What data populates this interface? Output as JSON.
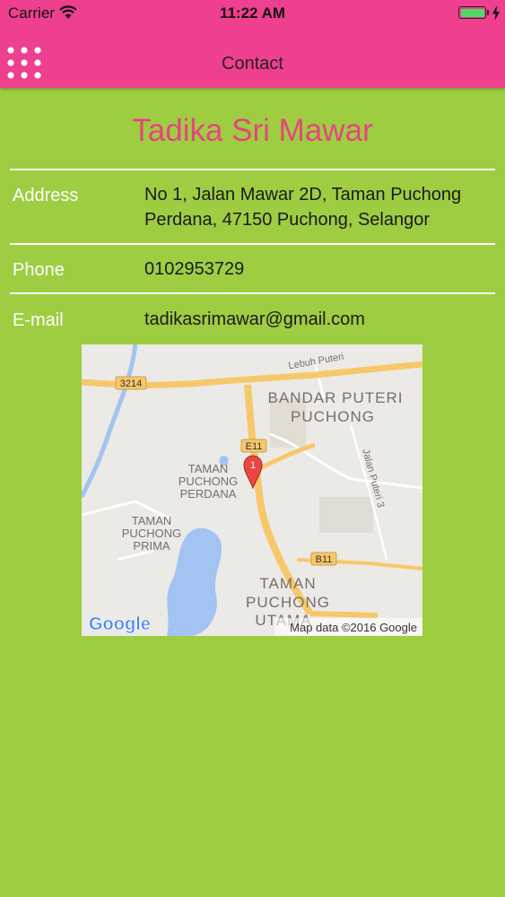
{
  "status_bar": {
    "carrier": "Carrier",
    "time": "11:22 AM",
    "wifi_icon": "wifi-icon",
    "battery_icon": "battery-icon",
    "battery_level_percent": 100,
    "charging_icon": "charging-bolt-icon"
  },
  "nav": {
    "menu_icon": "grid-menu-icon",
    "title": "Contact"
  },
  "school": {
    "name": "Tadika Sri Mawar"
  },
  "contact": {
    "address_label": "Address",
    "address_value": "No 1, Jalan Mawar 2D, Taman Puchong Perdana, 47150 Puchong, Selangor",
    "phone_label": "Phone",
    "phone_value": "0102953729",
    "email_label": "E-mail",
    "email_value": "tadikasrimawar@gmail.com"
  },
  "map": {
    "labels": {
      "bandar_puteri": "BANDAR PUTERI",
      "puchong": "PUCHONG",
      "taman1": "TAMAN",
      "puchong1": "PUCHONG",
      "perdana": "PERDANA",
      "taman2": "TAMAN",
      "puchong2": "PUCHONG",
      "prima": "PRIMA",
      "taman3": "TAMAN",
      "puchong3": "PUCHONG",
      "utama": "UTAMA",
      "lebuh_puteri": "Lebuh Puteri",
      "jalan_puteri": "Jalan Puteri 3",
      "route_3214": "3214",
      "route_e11": "E11",
      "route_b11": "B11"
    },
    "marker_label": "1",
    "google_logo": "Google",
    "attribution": "Map data ©2016 Google",
    "colors": {
      "land": "#ebeae6",
      "road": "#f7c86a",
      "water": "#a3c4f2",
      "park": "#cfe3b8"
    }
  },
  "colors": {
    "header": "#ef3f8f",
    "background": "#9ecd42",
    "title": "#e6457f"
  }
}
